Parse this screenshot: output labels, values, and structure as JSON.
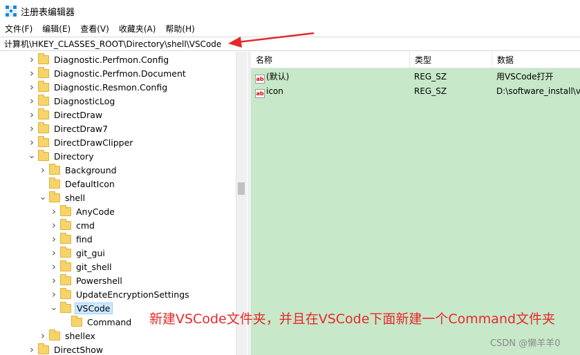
{
  "window": {
    "title": "注册表编辑器"
  },
  "menu": [
    "文件(F)",
    "编辑(E)",
    "查看(V)",
    "收藏夹(A)",
    "帮助(H)"
  ],
  "address": "计算机\\HKEY_CLASSES_ROOT\\Directory\\shell\\VSCode",
  "tree": [
    {
      "label": "Diagnostic.Perfmon.Config",
      "level": 0,
      "expander": ">"
    },
    {
      "label": "Diagnostic.Perfmon.Document",
      "level": 0,
      "expander": ">"
    },
    {
      "label": "Diagnostic.Resmon.Config",
      "level": 0,
      "expander": ">"
    },
    {
      "label": "DiagnosticLog",
      "level": 0,
      "expander": ">"
    },
    {
      "label": "DirectDraw",
      "level": 0,
      "expander": ">"
    },
    {
      "label": "DirectDraw7",
      "level": 0,
      "expander": ">"
    },
    {
      "label": "DirectDrawClipper",
      "level": 0,
      "expander": ">"
    },
    {
      "label": "Directory",
      "level": 0,
      "expander": "v"
    },
    {
      "label": "Background",
      "level": 1,
      "expander": ">"
    },
    {
      "label": "DefaultIcon",
      "level": 1,
      "expander": ""
    },
    {
      "label": "shell",
      "level": 1,
      "expander": "v"
    },
    {
      "label": "AnyCode",
      "level": 2,
      "expander": ">"
    },
    {
      "label": "cmd",
      "level": 2,
      "expander": ">"
    },
    {
      "label": "find",
      "level": 2,
      "expander": ">"
    },
    {
      "label": "git_gui",
      "level": 2,
      "expander": ">"
    },
    {
      "label": "git_shell",
      "level": 2,
      "expander": ">"
    },
    {
      "label": "Powershell",
      "level": 2,
      "expander": ">"
    },
    {
      "label": "UpdateEncryptionSettings",
      "level": 2,
      "expander": ">"
    },
    {
      "label": "VSCode",
      "level": 2,
      "expander": "v",
      "selected": true
    },
    {
      "label": "Command",
      "level": 3,
      "expander": ""
    },
    {
      "label": "shellex",
      "level": 1,
      "expander": ">"
    },
    {
      "label": "DirectShow",
      "level": 0,
      "expander": ">"
    }
  ],
  "list": {
    "headers": [
      "名称",
      "类型",
      "数据"
    ],
    "rows": [
      {
        "icon": "ab",
        "name": "(默认)",
        "type": "REG_SZ",
        "data": "用VSCode打开"
      },
      {
        "icon": "ab",
        "name": "icon",
        "type": "REG_SZ",
        "data": "D:\\software_install\\vs"
      }
    ]
  },
  "annotation": "新建VSCode文件夹，并且在VSCode下面新建一个Command文件夹",
  "watermark": "CSDN @懒羊羊0",
  "colors": {
    "list_bg": "#c7e8c9",
    "annotation": "#e8282a",
    "selection": "#cce8ff",
    "arrow": "#e8282a"
  }
}
